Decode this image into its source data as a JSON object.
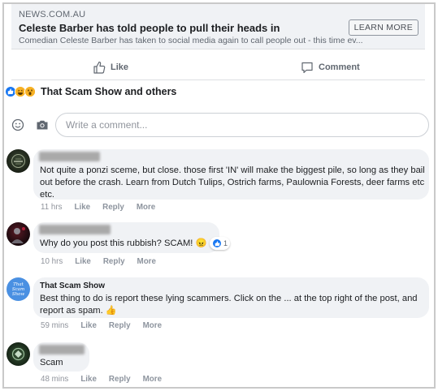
{
  "link_preview": {
    "domain": "NEWS.COM.AU",
    "title": "Celeste Barber has told people to pull their heads in",
    "description": "Comedian Celeste Barber has taken to social media again to call people out - this time ev...",
    "button": "LEARN MORE"
  },
  "actions": {
    "like": "Like",
    "comment": "Comment"
  },
  "reactions": {
    "text": "That Scam Show and others",
    "icons": [
      "like-icon",
      "haha-icon",
      "wow-icon"
    ]
  },
  "composer": {
    "placeholder": "Write a comment..."
  },
  "comments": [
    {
      "name": "",
      "text": "Not quite a ponzi sceme, but close. those first 'IN' will make the biggest pile, so long as they bail out before the crash. Learn from Dutch Tulips, Ostrich farms, Paulownia Forests, deer farms etc etc.",
      "time": "11 hrs",
      "like": "Like",
      "reply": "Reply",
      "more": "More"
    },
    {
      "name": "",
      "text": "Why do you post this rubbish? SCAM! 😠",
      "reaction_count": "1",
      "time": "10 hrs",
      "like": "Like",
      "reply": "Reply",
      "more": "More"
    },
    {
      "name": "That Scam Show",
      "avatar_text": "That Scam Show",
      "text": "Best thing to do is report these lying scammers. Click on the ... at the top right of the post, and report as spam. 👍",
      "time": "59 mins",
      "like": "Like",
      "reply": "Reply",
      "more": "More"
    },
    {
      "name": "",
      "text": "Scam",
      "time": "48 mins",
      "like": "Like",
      "reply": "Reply",
      "more": "More"
    }
  ],
  "colors": {
    "brand": "#1877f2",
    "bubble": "#f0f2f5",
    "muted": "#90949c"
  }
}
